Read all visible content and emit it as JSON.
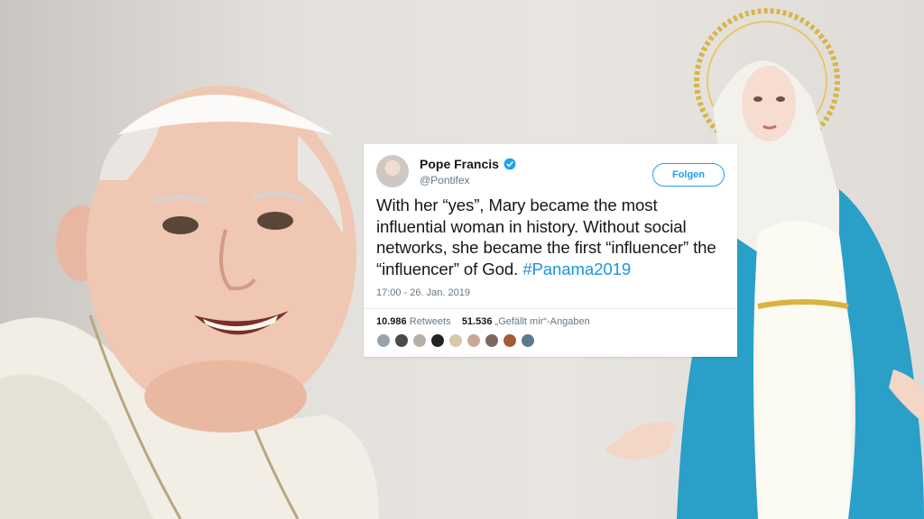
{
  "tweet": {
    "name": "Pope Francis",
    "handle": "@Pontifex",
    "follow_label": "Folgen",
    "text_main": "With her “yes”, Mary became the most influential woman in history. Without social networks, she became the first “influencer” the “influencer” of God. ",
    "hashtag": "#Panama2019",
    "timestamp": "17:00 - 26. Jan. 2019",
    "retweets_count": "10.986",
    "retweets_label": "Retweets",
    "likes_count": "51.536",
    "likes_label": "„Gefällt mir“-Angaben",
    "liker_avatars": [
      "#9aa3ab",
      "#4a4a4a",
      "#b5b0aa",
      "#222222",
      "#d8c8a8",
      "#c9a89a",
      "#7b6a5c",
      "#a55a3a",
      "#5f7a8a"
    ]
  },
  "colors": {
    "link": "#1b95e0",
    "follow": "#1da1f2",
    "verified": "#1da1f2"
  }
}
